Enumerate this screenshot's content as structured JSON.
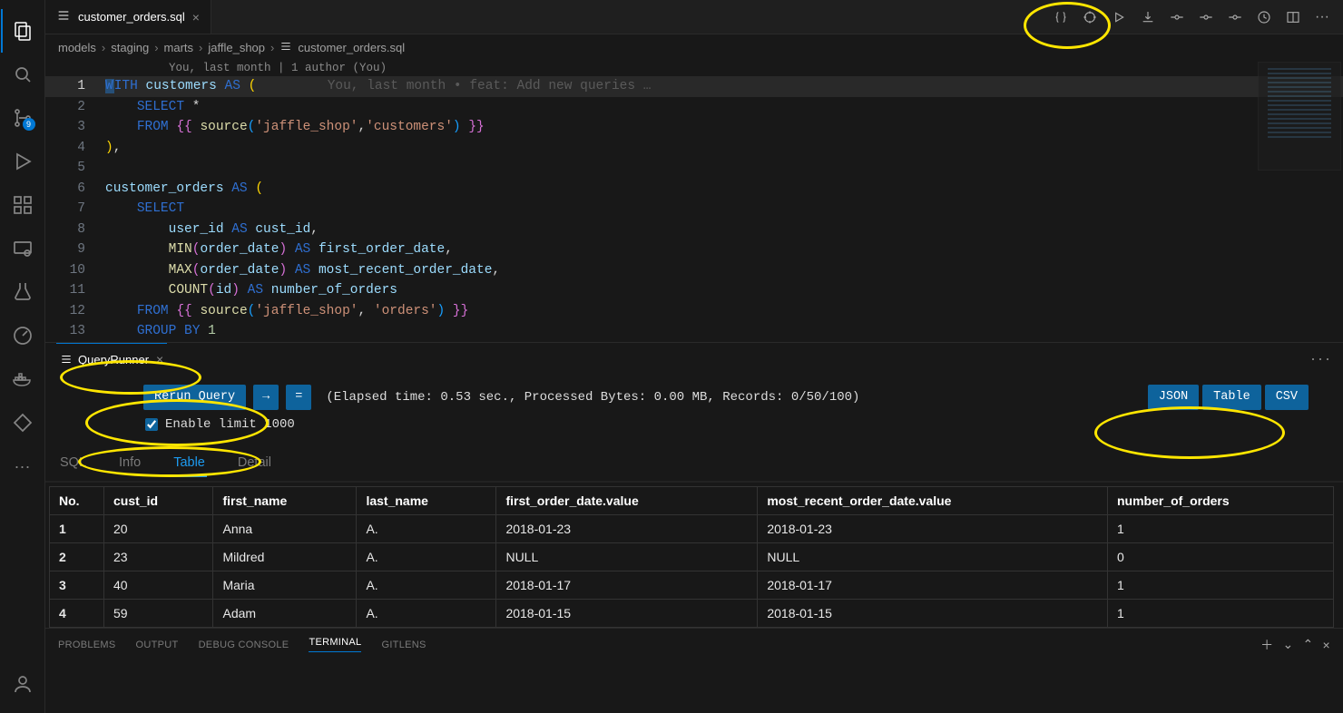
{
  "tab": {
    "filename": "customer_orders.sql",
    "close_tooltip": "Close"
  },
  "breadcrumb": [
    "models",
    "staging",
    "marts",
    "jaffle_shop",
    "customer_orders.sql"
  ],
  "codelens": "You, last month | 1 author (You)",
  "git_inline": "You, last month • feat: Add new queries …",
  "source_control_badge": "9",
  "code_lines": [
    {
      "n": 1
    },
    {
      "n": 2
    },
    {
      "n": 3
    },
    {
      "n": 4
    },
    {
      "n": 5
    },
    {
      "n": 6
    },
    {
      "n": 7
    },
    {
      "n": 8
    },
    {
      "n": 9
    },
    {
      "n": 10
    },
    {
      "n": 11
    },
    {
      "n": 12
    },
    {
      "n": 13
    }
  ],
  "panel": {
    "name": "QueryRunner",
    "rerun_label": "Rerun Query",
    "arrow_label": "→",
    "eq_label": "=",
    "status": "(Elapsed time: 0.53 sec., Processed Bytes: 0.00 MB, Records: 0/50/100)",
    "enable_limit_label": "Enable limit 1000",
    "formats": {
      "json": "JSON",
      "table": "Table",
      "csv": "CSV"
    },
    "viewtabs": [
      "SQL",
      "Info",
      "Table",
      "Detail"
    ]
  },
  "table": {
    "columns": [
      "No.",
      "cust_id",
      "first_name",
      "last_name",
      "first_order_date.value",
      "most_recent_order_date.value",
      "number_of_orders"
    ],
    "rows": [
      [
        "1",
        "20",
        "Anna",
        "A.",
        "2018-01-23",
        "2018-01-23",
        "1"
      ],
      [
        "2",
        "23",
        "Mildred",
        "A.",
        "NULL",
        "NULL",
        "0"
      ],
      [
        "3",
        "40",
        "Maria",
        "A.",
        "2018-01-17",
        "2018-01-17",
        "1"
      ],
      [
        "4",
        "59",
        "Adam",
        "A.",
        "2018-01-15",
        "2018-01-15",
        "1"
      ]
    ]
  },
  "bottom_tabs": [
    "PROBLEMS",
    "OUTPUT",
    "DEBUG CONSOLE",
    "TERMINAL",
    "GITLENS"
  ]
}
